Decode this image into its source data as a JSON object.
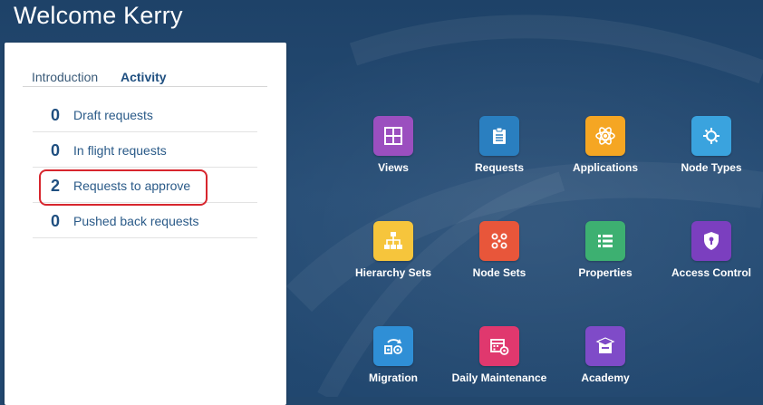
{
  "header": {
    "title": "Welcome Kerry"
  },
  "tabs": [
    {
      "label": "Introduction",
      "active": false
    },
    {
      "label": "Activity",
      "active": true
    }
  ],
  "activity": [
    {
      "count": "0",
      "label": "Draft requests"
    },
    {
      "count": "0",
      "label": "In flight requests"
    },
    {
      "count": "2",
      "label": "Requests to approve",
      "highlighted": true
    },
    {
      "count": "0",
      "label": "Pushed back requests"
    }
  ],
  "tiles": [
    {
      "label": "Views",
      "icon": "grid-icon",
      "color": "#9b4fbf"
    },
    {
      "label": "Requests",
      "icon": "clipboard-icon",
      "color": "#2a7fc0"
    },
    {
      "label": "Applications",
      "icon": "atom-icon",
      "color": "#f5a623"
    },
    {
      "label": "Node Types",
      "icon": "gear-node-icon",
      "color": "#3aa3de"
    },
    {
      "label": "Hierarchy Sets",
      "icon": "hierarchy-icon",
      "color": "#f6c53c"
    },
    {
      "label": "Node Sets",
      "icon": "node-set-icon",
      "color": "#e8563a"
    },
    {
      "label": "Properties",
      "icon": "list-icon",
      "color": "#3db071"
    },
    {
      "label": "Access Control",
      "icon": "shield-lock-icon",
      "color": "#7b3fbf"
    },
    {
      "label": "Migration",
      "icon": "migration-icon",
      "color": "#2f8fd6"
    },
    {
      "label": "Daily Maintenance",
      "icon": "calendar-gear-icon",
      "color": "#e0386e"
    },
    {
      "label": "Academy",
      "icon": "academy-icon",
      "color": "#7f4bc8"
    }
  ],
  "colors": {
    "highlight_border": "#d7262e",
    "count_text": "#1f4f80"
  }
}
